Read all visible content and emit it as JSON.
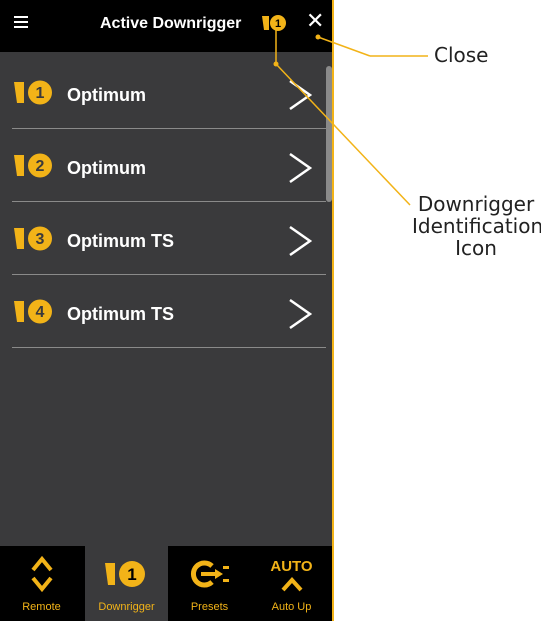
{
  "header": {
    "title": "Active Downrigger",
    "active_number": "1",
    "close_glyph": "✕"
  },
  "downriggers": [
    {
      "number": "1",
      "label": "Optimum"
    },
    {
      "number": "2",
      "label": "Optimum"
    },
    {
      "number": "3",
      "label": "Optimum TS"
    },
    {
      "number": "4",
      "label": "Optimum TS"
    }
  ],
  "bottom_nav": {
    "remote": "Remote",
    "downrigger": "Downrigger",
    "downrigger_number": "1",
    "presets": "Presets",
    "auto_up": "Auto Up",
    "auto_text": "AUTO"
  },
  "callouts": {
    "close": "Close",
    "identification_line1": "Downrigger",
    "identification_line2": "Identification",
    "identification_line3": "Icon"
  },
  "colors": {
    "accent": "#f2b318",
    "background": "#3a3a3c",
    "bar": "#000000"
  }
}
